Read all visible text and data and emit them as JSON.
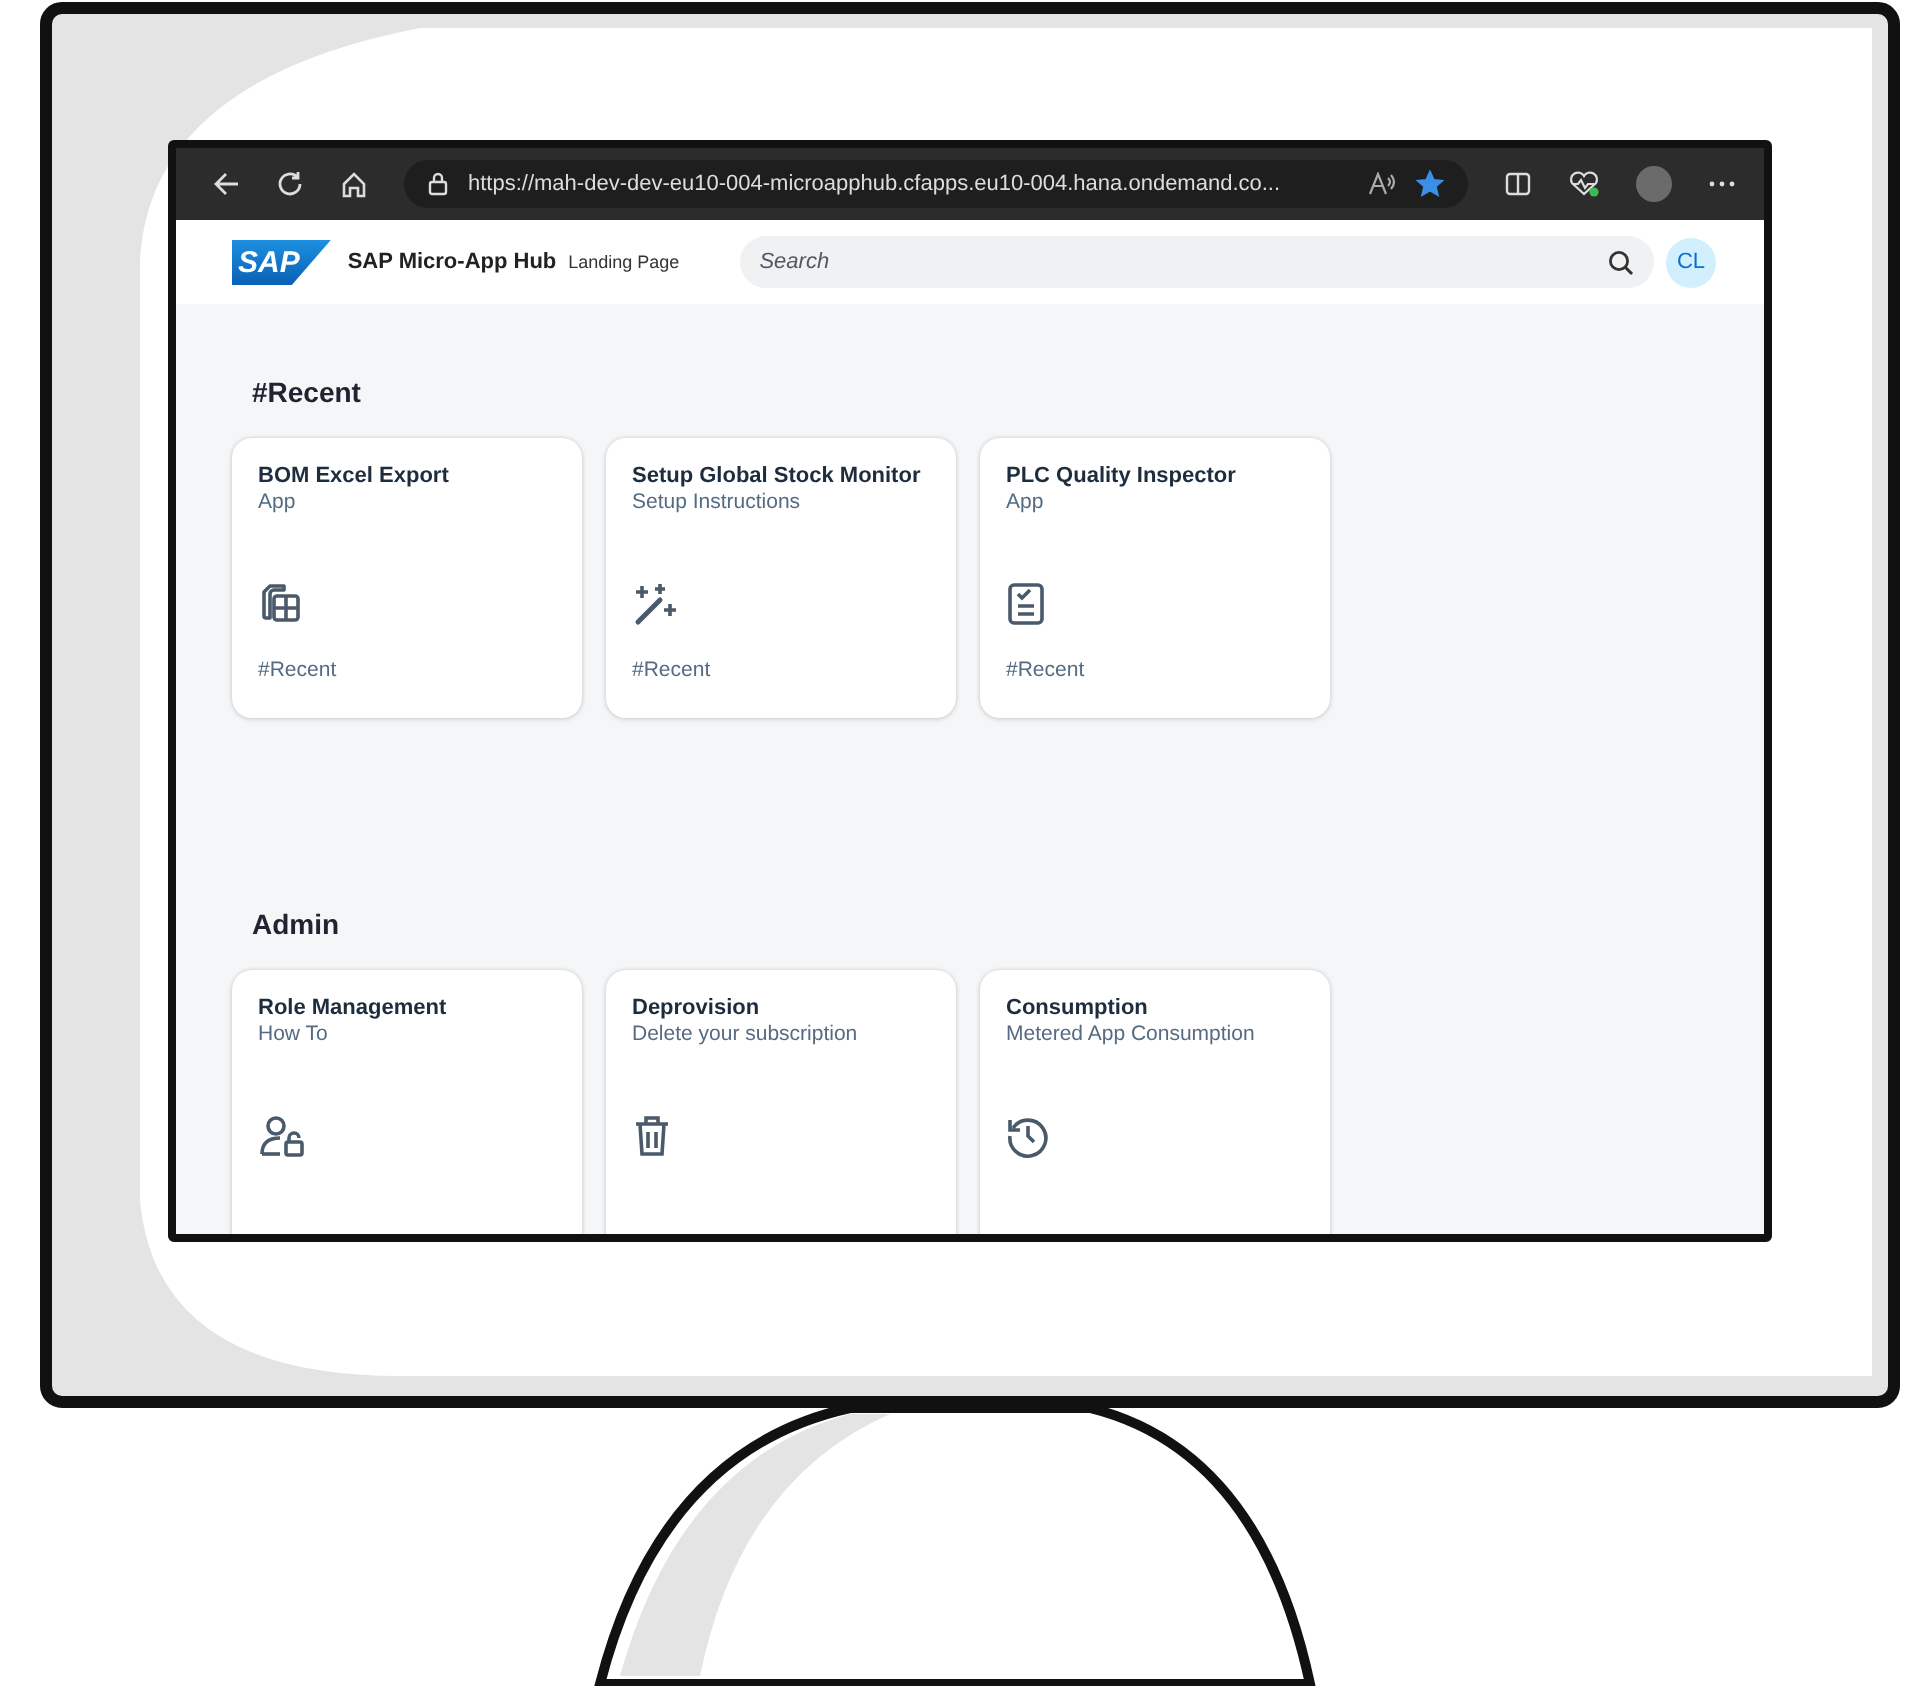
{
  "browser": {
    "url": "https://mah-dev-dev-eu10-004-microapphub.cfapps.eu10-004.hana.ondemand.co...",
    "favorite": true
  },
  "header": {
    "logo": "SAP",
    "title": "SAP Micro-App Hub",
    "subtitle": "Landing Page",
    "search": {
      "placeholder": "Search"
    },
    "avatar": "CL"
  },
  "sections": [
    {
      "title": "#Recent",
      "cards": [
        {
          "title": "BOM Excel Export",
          "subtitle": "App",
          "kind": "table",
          "tag": "#Recent"
        },
        {
          "title": "Setup Global Stock Monitor",
          "subtitle": "Setup Instructions",
          "kind": "wand",
          "tag": "#Recent"
        },
        {
          "title": "PLC Quality Inspector",
          "subtitle": "App",
          "kind": "checklist",
          "tag": "#Recent"
        }
      ]
    },
    {
      "title": "Admin",
      "cards": [
        {
          "title": "Role Management",
          "subtitle": "How To",
          "kind": "user-lock"
        },
        {
          "title": "Deprovision",
          "subtitle": "Delete your subscription",
          "kind": "trash"
        },
        {
          "title": "Consumption",
          "subtitle": "Metered App Consumption",
          "kind": "history"
        }
      ]
    }
  ]
}
